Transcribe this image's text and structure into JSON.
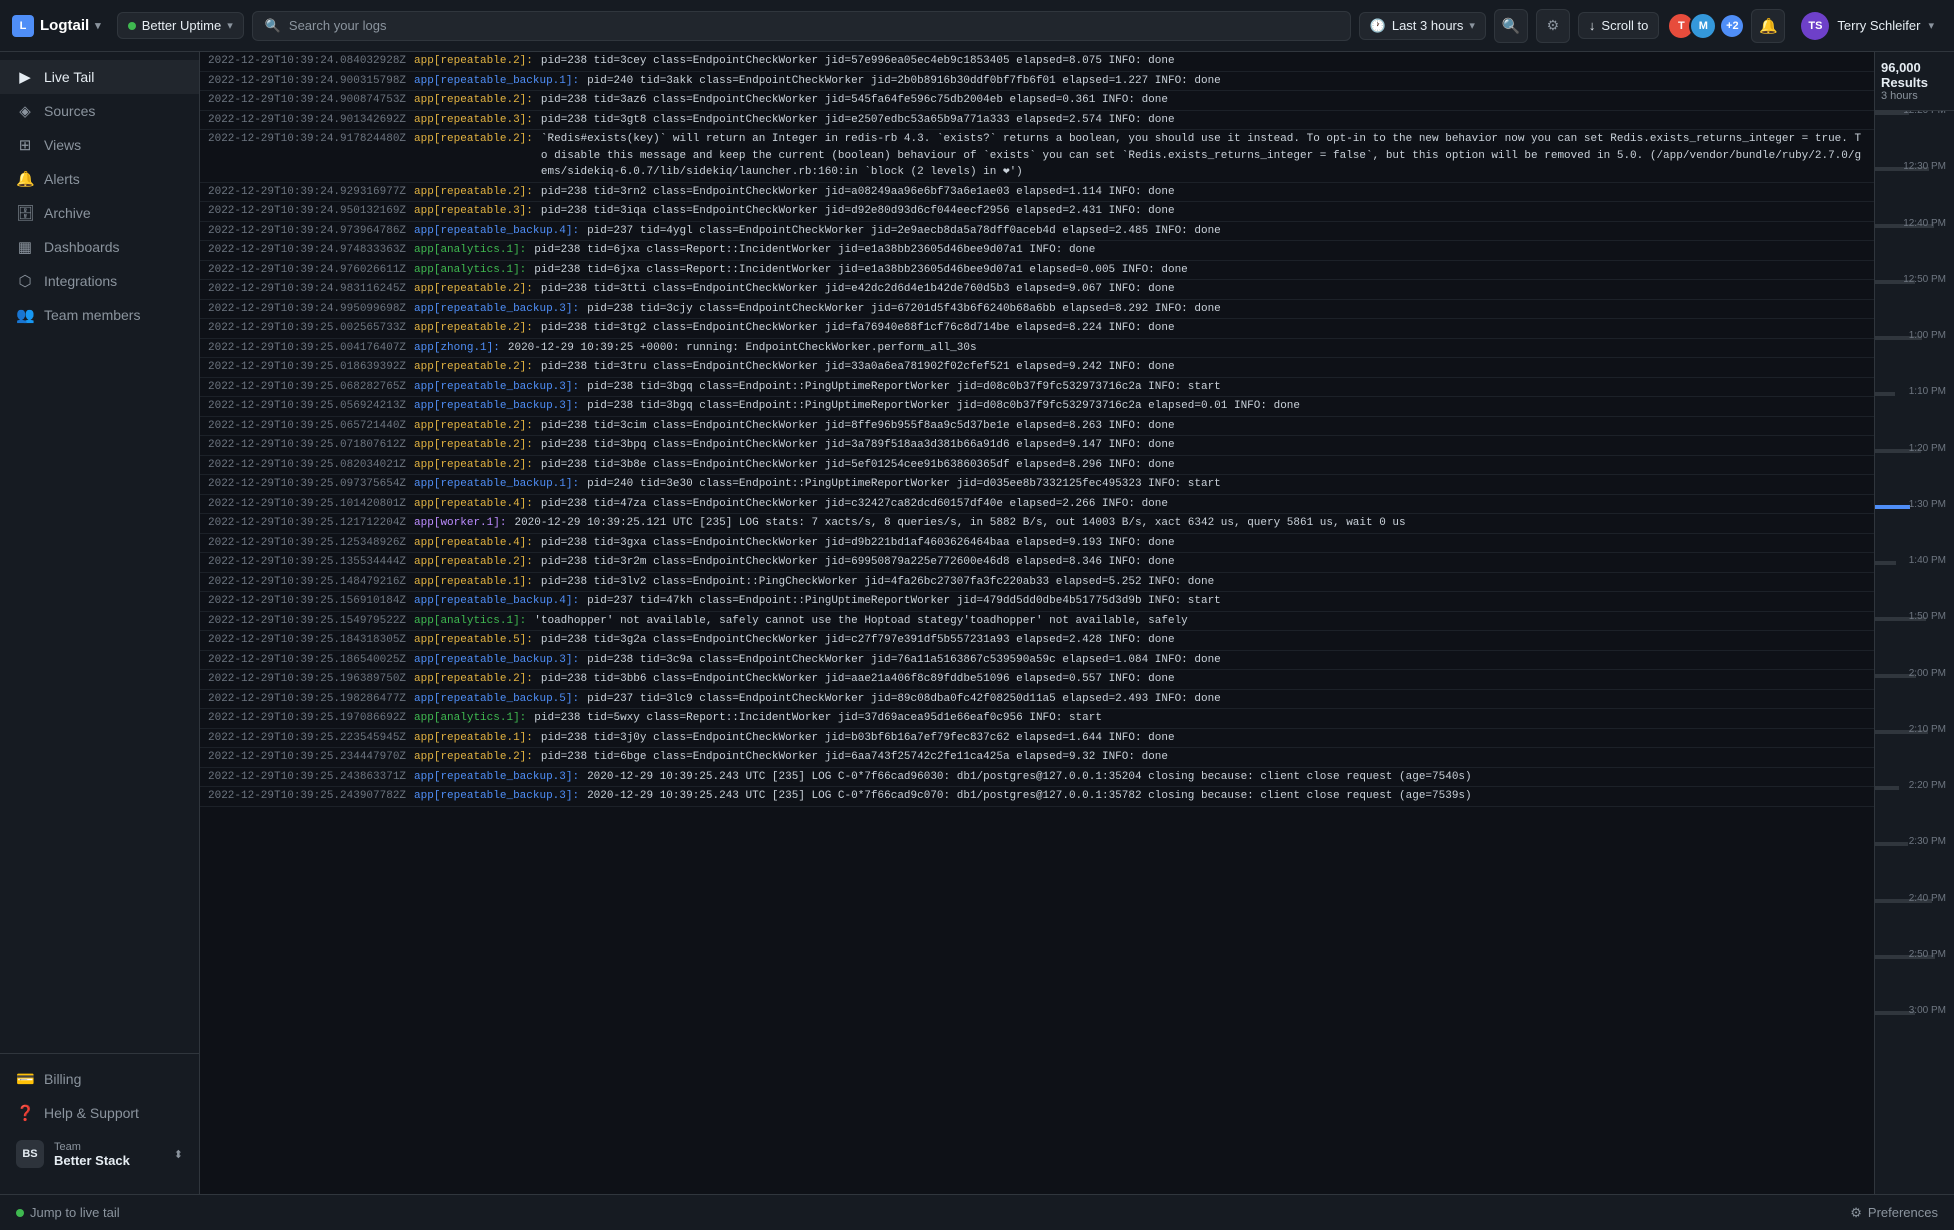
{
  "topbar": {
    "logo": "Logtail",
    "source": "Better Uptime",
    "search_placeholder": "Search your logs",
    "time_range": "Last 3 hours",
    "scroll_to": "Scroll to",
    "user_name": "Terry Schleifer",
    "avatar_count": "+2"
  },
  "sidebar": {
    "items": [
      {
        "id": "live-tail",
        "label": "Live Tail",
        "icon": "▶",
        "active": true
      },
      {
        "id": "sources",
        "label": "Sources",
        "icon": "◈",
        "active": false
      },
      {
        "id": "views",
        "label": "Views",
        "icon": "⊞",
        "active": false
      },
      {
        "id": "alerts",
        "label": "Alerts",
        "icon": "🔔",
        "active": false
      },
      {
        "id": "archive",
        "label": "Archive",
        "icon": "🗄",
        "active": false
      },
      {
        "id": "dashboards",
        "label": "Dashboards",
        "icon": "▦",
        "active": false
      },
      {
        "id": "integrations",
        "label": "Integrations",
        "icon": "⬡",
        "active": false
      },
      {
        "id": "team-members",
        "label": "Team members",
        "icon": "👥",
        "active": false
      }
    ],
    "bottom": [
      {
        "id": "billing",
        "label": "Billing",
        "icon": "💳"
      },
      {
        "id": "help",
        "label": "Help & Support",
        "icon": "❓"
      }
    ],
    "team": {
      "label": "Team",
      "name": "Better Stack"
    }
  },
  "minimap": {
    "results_count": "96,000 Results",
    "results_sub": "3 hours",
    "ticks": [
      "12:20 PM",
      "12:30 PM",
      "12:40 PM",
      "12:50 PM",
      "1:00 PM",
      "1:10 PM",
      "1:20 PM",
      "1:30 PM",
      "1:40 PM",
      "1:50 PM",
      "2:00 PM",
      "2:10 PM",
      "2:20 PM",
      "2:30 PM",
      "2:40 PM",
      "2:50 PM",
      "3:00 PM"
    ]
  },
  "bottombar": {
    "jump_live": "Jump to live tail",
    "preferences": "Preferences"
  },
  "logs": [
    {
      "ts": "2022-12-29T10:39:24.084032928Z",
      "source": "app[repeatable.2]:",
      "source_color": "orange",
      "msg": "pid=238 tid=3cey class=EndpointCheckWorker jid=57e996ea05ec4eb9c1853405 elapsed=8.075 INFO: done"
    },
    {
      "ts": "2022-12-29T10:39:24.900315798Z",
      "source": "app[repeatable_backup.1]:",
      "source_color": "blue",
      "msg": "pid=240 tid=3akk class=EndpointCheckWorker jid=2b0b8916b30ddf0bf7fb6f01 elapsed=1.227 INFO: done"
    },
    {
      "ts": "2022-12-29T10:39:24.900874753Z",
      "source": "app[repeatable.2]:",
      "source_color": "orange",
      "msg": "pid=238 tid=3az6 class=EndpointCheckWorker jid=545fa64fe596c75db2004eb elapsed=0.361 INFO: done"
    },
    {
      "ts": "2022-12-29T10:39:24.901342692Z",
      "source": "app[repeatable.3]:",
      "source_color": "orange",
      "msg": "pid=238 tid=3gt8 class=EndpointCheckWorker jid=e2507edbc53a65b9a771a333 elapsed=2.574 INFO: done"
    },
    {
      "ts": "2022-12-29T10:39:24.917824480Z",
      "source": "app[repeatable.2]:",
      "source_color": "orange",
      "msg": "`Redis#exists(key)` will return an Integer in redis-rb 4.3. `exists?` returns a boolean, you should use it instead. To opt-in to the new behavior now you can set Redis.exists_returns_integer = true. To disable this message and keep the current (boolean) behaviour of `exists` you can set `Redis.exists_returns_integer = false`, but this option will be removed in 5.0. (/app/vendor/bundle/ruby/2.7.0/gems/sidekiq-6.0.7/lib/sidekiq/launcher.rb:160:in `block (2 levels) in ❤')"
    },
    {
      "ts": "2022-12-29T10:39:24.929316977Z",
      "source": "app[repeatable.2]:",
      "source_color": "orange",
      "msg": "pid=238 tid=3rn2 class=EndpointCheckWorker jid=a08249aa96e6bf73a6e1ae03 elapsed=1.114 INFO: done"
    },
    {
      "ts": "2022-12-29T10:39:24.950132169Z",
      "source": "app[repeatable.3]:",
      "source_color": "orange",
      "msg": "pid=238 tid=3iqa class=EndpointCheckWorker jid=d92e80d93d6cf044eecf2956 elapsed=2.431 INFO: done"
    },
    {
      "ts": "2022-12-29T10:39:24.973964786Z",
      "source": "app[repeatable_backup.4]:",
      "source_color": "blue",
      "msg": "pid=237 tid=4ygl class=EndpointCheckWorker jid=2e9aecb8da5a78dff0aceb4d elapsed=2.485 INFO: done"
    },
    {
      "ts": "2022-12-29T10:39:24.974833363Z",
      "source": "app[analytics.1]:",
      "source_color": "green",
      "msg": "pid=238 tid=6jxa class=Report::IncidentWorker jid=e1a38bb23605d46bee9d07a1 INFO: done"
    },
    {
      "ts": "2022-12-29T10:39:24.976026611Z",
      "source": "app[analytics.1]:",
      "source_color": "green",
      "msg": "pid=238 tid=6jxa class=Report::IncidentWorker jid=e1a38bb23605d46bee9d07a1 elapsed=0.005 INFO: done"
    },
    {
      "ts": "2022-12-29T10:39:24.983116245Z",
      "source": "app[repeatable.2]:",
      "source_color": "orange",
      "msg": "pid=238 tid=3tti class=EndpointCheckWorker jid=e42dc2d6d4e1b42de760d5b3 elapsed=9.067 INFO: done"
    },
    {
      "ts": "2022-12-29T10:39:24.995099698Z",
      "source": "app[repeatable_backup.3]:",
      "source_color": "blue",
      "msg": "pid=238 tid=3cjy class=EndpointCheckWorker jid=67201d5f43b6f6240b68a6bb elapsed=8.292 INFO: done"
    },
    {
      "ts": "2022-12-29T10:39:25.002565733Z",
      "source": "app[repeatable.2]:",
      "source_color": "orange",
      "msg": "pid=238 tid=3tg2 class=EndpointCheckWorker jid=fa76940e88f1cf76c8d714be elapsed=8.224 INFO: done"
    },
    {
      "ts": "2022-12-29T10:39:25.004176407Z",
      "source": "app[zhong.1]:",
      "source_color": "blue",
      "msg": "2020-12-29 10:39:25 +0000: running: EndpointCheckWorker.perform_all_30s"
    },
    {
      "ts": "2022-12-29T10:39:25.018639392Z",
      "source": "app[repeatable.2]:",
      "source_color": "orange",
      "msg": "pid=238 tid=3tru class=EndpointCheckWorker jid=33a0a6ea781902f02cfef521 elapsed=9.242 INFO: done"
    },
    {
      "ts": "2022-12-29T10:39:25.068282765Z",
      "source": "app[repeatable_backup.3]:",
      "source_color": "blue",
      "msg": "pid=238 tid=3bgq class=Endpoint::PingUptimeReportWorker jid=d08c0b37f9fc532973716c2a INFO: start"
    },
    {
      "ts": "2022-12-29T10:39:25.056924213Z",
      "source": "app[repeatable_backup.3]:",
      "source_color": "blue",
      "msg": "pid=238 tid=3bgq class=Endpoint::PingUptimeReportWorker jid=d08c0b37f9fc532973716c2a elapsed=0.01 INFO: done"
    },
    {
      "ts": "2022-12-29T10:39:25.065721440Z",
      "source": "app[repeatable.2]:",
      "source_color": "orange",
      "msg": "pid=238 tid=3cim class=EndpointCheckWorker jid=8ffe96b955f8aa9c5d37be1e elapsed=8.263 INFO: done"
    },
    {
      "ts": "2022-12-29T10:39:25.071807612Z",
      "source": "app[repeatable.2]:",
      "source_color": "orange",
      "msg": "pid=238 tid=3bpq class=EndpointCheckWorker jid=3a789f518aa3d381b66a91d6 elapsed=9.147 INFO: done"
    },
    {
      "ts": "2022-12-29T10:39:25.082034021Z",
      "source": "app[repeatable.2]:",
      "source_color": "orange",
      "msg": "pid=238 tid=3b8e class=EndpointCheckWorker jid=5ef01254cee91b63860365df elapsed=8.296 INFO: done"
    },
    {
      "ts": "2022-12-29T10:39:25.097375654Z",
      "source": "app[repeatable_backup.1]:",
      "source_color": "blue",
      "msg": "pid=240 tid=3e30 class=Endpoint::PingUptimeReportWorker jid=d035ee8b7332125fec495323 INFO: start"
    },
    {
      "ts": "2022-12-29T10:39:25.101420801Z",
      "source": "app[repeatable.4]:",
      "source_color": "orange",
      "msg": "pid=238 tid=47za class=EndpointCheckWorker jid=c32427ca82dcd60157df40e elapsed=2.266 INFO: done"
    },
    {
      "ts": "2022-12-29T10:39:25.121712204Z",
      "source": "app[worker.1]:",
      "source_color": "purple",
      "msg": "2020-12-29 10:39:25.121 UTC [235] LOG stats: 7 xacts/s, 8 queries/s, in 5882 B/s, out 14003 B/s, xact 6342 us, query 5861 us, wait 0 us"
    },
    {
      "ts": "2022-12-29T10:39:25.125348926Z",
      "source": "app[repeatable.4]:",
      "source_color": "orange",
      "msg": "pid=238 tid=3gxa class=EndpointCheckWorker jid=d9b221bd1af4603626464baa elapsed=9.193 INFO: done"
    },
    {
      "ts": "2022-12-29T10:39:25.135534444Z",
      "source": "app[repeatable.2]:",
      "source_color": "orange",
      "msg": "pid=238 tid=3r2m class=EndpointCheckWorker jid=69950879a225e772600e46d8 elapsed=8.346 INFO: done"
    },
    {
      "ts": "2022-12-29T10:39:25.148479216Z",
      "source": "app[repeatable.1]:",
      "source_color": "orange",
      "msg": "pid=238 tid=3lv2 class=Endpoint::PingCheckWorker jid=4fa26bc27307fa3fc220ab33 elapsed=5.252 INFO: done"
    },
    {
      "ts": "2022-12-29T10:39:25.156910184Z",
      "source": "app[repeatable_backup.4]:",
      "source_color": "blue",
      "msg": "pid=237 tid=47kh class=Endpoint::PingUptimeReportWorker jid=479dd5dd0dbe4b51775d3d9b INFO: start"
    },
    {
      "ts": "2022-12-29T10:39:25.154979522Z",
      "source": "app[analytics.1]:",
      "source_color": "green",
      "msg": "'toadhopper' not available, safely cannot use the Hoptoad stategy'toadhopper' not available, safely"
    },
    {
      "ts": "2022-12-29T10:39:25.184318305Z",
      "source": "app[repeatable.5]:",
      "source_color": "orange",
      "msg": "pid=238 tid=3g2a class=EndpointCheckWorker jid=c27f797e391df5b557231a93 elapsed=2.428 INFO: done"
    },
    {
      "ts": "2022-12-29T10:39:25.186540025Z",
      "source": "app[repeatable_backup.3]:",
      "source_color": "blue",
      "msg": "pid=238 tid=3c9a class=EndpointCheckWorker jid=76a11a5163867c539590a59c elapsed=1.084 INFO: done"
    },
    {
      "ts": "2022-12-29T10:39:25.196389750Z",
      "source": "app[repeatable.2]:",
      "source_color": "orange",
      "msg": "pid=238 tid=3bb6 class=EndpointCheckWorker jid=aae21a406f8c89fddbe51096 elapsed=0.557 INFO: done"
    },
    {
      "ts": "2022-12-29T10:39:25.198286477Z",
      "source": "app[repeatable_backup.5]:",
      "source_color": "blue",
      "msg": "pid=237 tid=3lc9 class=EndpointCheckWorker jid=89c08dba0fc42f08250d11a5 elapsed=2.493 INFO: done"
    },
    {
      "ts": "2022-12-29T10:39:25.197086692Z",
      "source": "app[analytics.1]:",
      "source_color": "green",
      "msg": "pid=238 tid=5wxy class=Report::IncidentWorker jid=37d69acea95d1e66eaf0c956 INFO: start"
    },
    {
      "ts": "2022-12-29T10:39:25.223545945Z",
      "source": "app[repeatable.1]:",
      "source_color": "orange",
      "msg": "pid=238 tid=3j0y class=EndpointCheckWorker jid=b03bf6b16a7ef79fec837c62 elapsed=1.644 INFO: done"
    },
    {
      "ts": "2022-12-29T10:39:25.234447970Z",
      "source": "app[repeatable.2]:",
      "source_color": "orange",
      "msg": "pid=238 tid=6bge class=EndpointCheckWorker jid=6aa743f25742c2fe11ca425a elapsed=9.32 INFO: done"
    },
    {
      "ts": "2022-12-29T10:39:25.243863371Z",
      "source": "app[repeatable_backup.3]:",
      "source_color": "blue",
      "msg": "2020-12-29 10:39:25.243 UTC [235] LOG C-0*7f66cad96030: db1/postgres@127.0.0.1:35204 closing because: client close request (age=7540s)"
    },
    {
      "ts": "2022-12-29T10:39:25.243907782Z",
      "source": "app[repeatable_backup.3]:",
      "source_color": "blue",
      "msg": "2020-12-29 10:39:25.243 UTC [235] LOG C-0*7f66cad9c070: db1/postgres@127.0.0.1:35782 closing because: client close request (age=7539s)"
    }
  ]
}
